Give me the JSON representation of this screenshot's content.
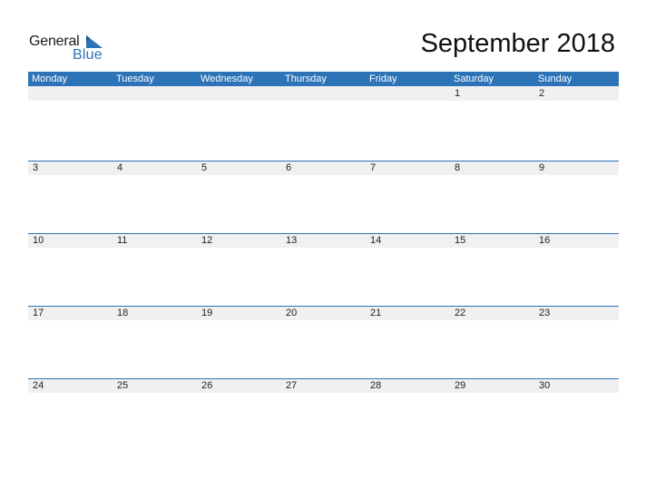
{
  "logo": {
    "line1": "General",
    "line2": "Blue",
    "icon": "flag-triangle-icon",
    "brand_color": "#2d73b8"
  },
  "title": "September 2018",
  "calendar": {
    "header_color": "#2d73b8",
    "weekdays": [
      "Monday",
      "Tuesday",
      "Wednesday",
      "Thursday",
      "Friday",
      "Saturday",
      "Sunday"
    ],
    "weeks": [
      [
        "",
        "",
        "",
        "",
        "",
        "1",
        "2"
      ],
      [
        "3",
        "4",
        "5",
        "6",
        "7",
        "8",
        "9"
      ],
      [
        "10",
        "11",
        "12",
        "13",
        "14",
        "15",
        "16"
      ],
      [
        "17",
        "18",
        "19",
        "20",
        "21",
        "22",
        "23"
      ],
      [
        "24",
        "25",
        "26",
        "27",
        "28",
        "29",
        "30"
      ]
    ]
  }
}
